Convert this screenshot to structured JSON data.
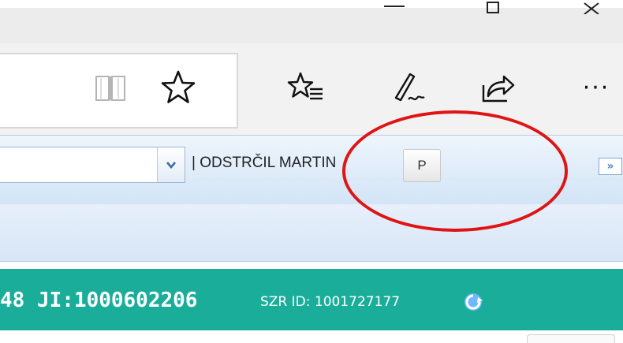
{
  "window_controls": {
    "minimize_icon": "minimize-icon",
    "restore_icon": "restore-icon",
    "close_icon": "close-icon"
  },
  "toolbar": {
    "reading_view_icon": "book-icon",
    "favorite_icon": "star-icon",
    "favorites_list_icon": "favorites-icon",
    "notes_icon": "pen-icon",
    "share_icon": "share-icon",
    "more_label": "···"
  },
  "app_header": {
    "user_label": "| ODSTRČIL MARTIN",
    "p_button_label": "P",
    "expand_label": "»"
  },
  "status_bar": {
    "ji_text": "48 JI:1000602206",
    "szr_text": "SZR ID: 1001727177"
  },
  "colors": {
    "teal": "#1aae9a",
    "highlight": "#e01414",
    "header": "#d2e4f6"
  }
}
